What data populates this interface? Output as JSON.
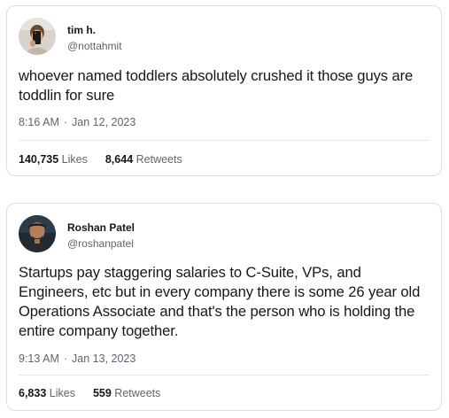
{
  "tweets": [
    {
      "display_name": "tim h.",
      "handle": "@nottahmit",
      "text": "whoever named toddlers absolutely crushed it those guys are toddlin for sure",
      "time": "8:16 AM",
      "separator": "·",
      "date": "Jan 12, 2023",
      "likes_count": "140,735",
      "likes_label": "Likes",
      "retweets_count": "8,644",
      "retweets_label": "Retweets",
      "avatar_icon": "profile-photo-icon"
    },
    {
      "display_name": "Roshan Patel",
      "handle": "@roshanpatel",
      "text": "Startups pay staggering salaries to C-Suite, VPs, and Engineers, etc but in every company there is some 26 year old Operations Associate and that's the person who is holding the entire company together.",
      "time": "9:13 AM",
      "separator": "·",
      "date": "Jan 13, 2023",
      "likes_count": "6,833",
      "likes_label": "Likes",
      "retweets_count": "559",
      "retweets_label": "Retweets",
      "avatar_icon": "profile-photo-icon"
    }
  ]
}
